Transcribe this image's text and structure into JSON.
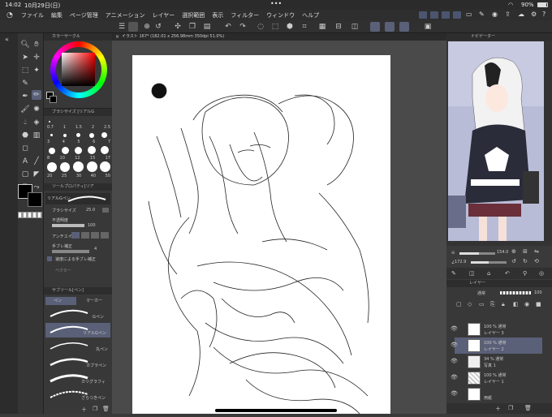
{
  "status": {
    "time": "14:02",
    "date": "10月29日(日)",
    "dots": "•••",
    "battery": "90%"
  },
  "menu": [
    "ファイル",
    "編集",
    "ページ管理",
    "アニメーション",
    "レイヤー",
    "選択範囲",
    "表示",
    "フィルター",
    "ウィンドウ",
    "ヘルプ"
  ],
  "doc_tab": "イラスト 167* (182.01 x 256.98mm 350dpi 51.0%)",
  "panels": {
    "color_wheel": "カラーサークル",
    "brush_size": "ブラシサイズ [リアルG",
    "tool_property": "ツールプロパティ[リア",
    "sub_tool": "サブツール[ペン]",
    "navigator": "ナビゲーター",
    "layer": "レイヤー"
  },
  "brush_sizes_row1": [
    "0.7",
    "1",
    "1.5",
    "2",
    "2.5"
  ],
  "brush_sizes_row2": [
    "3",
    "4",
    "5",
    "6",
    "7"
  ],
  "brush_sizes_row3": [
    "8",
    "10",
    "12",
    "15",
    "17"
  ],
  "brush_sizes_row4": [
    "20",
    "25",
    "30",
    "40",
    "50"
  ],
  "tool_props": {
    "preset": "リアルGペン",
    "brush_size_label": "ブラシサイズ",
    "brush_size_value": "25.0",
    "opacity_label": "不透明度",
    "opacity_value": "100",
    "antialias_label": "アンチエイリ",
    "stabilize_label": "手ブレ補正",
    "stabilize_value": "4",
    "speed_label": "速度による手ブレ補正",
    "vector_label": "ベクター"
  },
  "subtool_tabs": [
    "ペン",
    "マーカー"
  ],
  "subtools": [
    "Gペン",
    "リアルGペン",
    "丸ペン",
    "カブラペン",
    "カリグラフィ",
    "ざらつきペン"
  ],
  "nav": {
    "zoom": "154.0",
    "angle": "172.9",
    "zoom_slider_fraction": 0.55,
    "angle_slider_fraction": 0.5
  },
  "layer_blend": "通常",
  "layer_opacity": "100",
  "layers": [
    {
      "opacity": "100 % 通常",
      "name": "レイヤー 3",
      "selected": false
    },
    {
      "opacity": "100 % 通常",
      "name": "レイヤー 2",
      "selected": true
    },
    {
      "opacity": "34 % 通常",
      "name": "写真 1",
      "selected": false
    },
    {
      "opacity": "100 % 通常",
      "name": "レイヤー 1",
      "selected": false
    },
    {
      "opacity": "",
      "name": "用紙",
      "selected": false
    }
  ],
  "colors": {
    "accent": "#5a6078",
    "panel": "#383838",
    "paper": "#ffffff"
  }
}
